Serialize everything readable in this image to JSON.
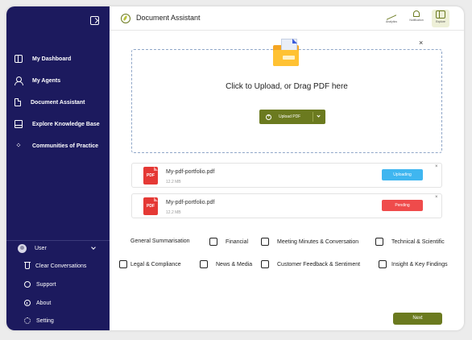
{
  "sidebar": {
    "items": [
      {
        "label": "My Dashboard",
        "icon": "dashboard-icon"
      },
      {
        "label": "My Agents",
        "icon": "agent-icon"
      },
      {
        "label": "Document Assistant",
        "icon": "document-icon"
      },
      {
        "label": "Explore Knowledge Base",
        "icon": "book-icon"
      },
      {
        "label": "Communities of Practice",
        "icon": "people-icon"
      }
    ],
    "user": {
      "label": "User"
    },
    "sub_items": [
      {
        "label": "Clear Conversations",
        "icon": "trash-icon"
      },
      {
        "label": "Support",
        "icon": "support-icon"
      },
      {
        "label": "About",
        "icon": "info-icon"
      },
      {
        "label": "Setting",
        "icon": "gear-icon"
      }
    ]
  },
  "header": {
    "title": "Document Assistant",
    "actions": [
      {
        "label": "Analytics",
        "icon": "analytics-icon"
      },
      {
        "label": "Notification",
        "icon": "bell-icon"
      },
      {
        "label": "Explore",
        "icon": "panel-icon"
      }
    ]
  },
  "upload": {
    "title": "Click to Upload, or Drag PDF here",
    "button_label": "Upload PDF",
    "close_glyph": "×"
  },
  "files": [
    {
      "name": "My-pdf-portfolio.pdf",
      "size": "12.2 MB",
      "status": "Uploading",
      "status_color": "#3fb6f0",
      "badge": "PDF"
    },
    {
      "name": "My-pdf-portfolio.pdf",
      "size": "12.2 MB",
      "status": "Pending",
      "status_color": "#ef4b4b",
      "badge": "PDF"
    }
  ],
  "categories": {
    "row1": [
      "General Summarisation",
      "Financial",
      "Meeting Minutes & Conversation",
      "Technical & Scientific"
    ],
    "row2": [
      "Legal & Compliance",
      "News & Media",
      "Customer Feedback & Sentiment",
      "Insight & Key Findings"
    ]
  },
  "next_label": "Next",
  "colors": {
    "sidebar": "#1c1a5e",
    "accent": "#6b7a1f"
  }
}
